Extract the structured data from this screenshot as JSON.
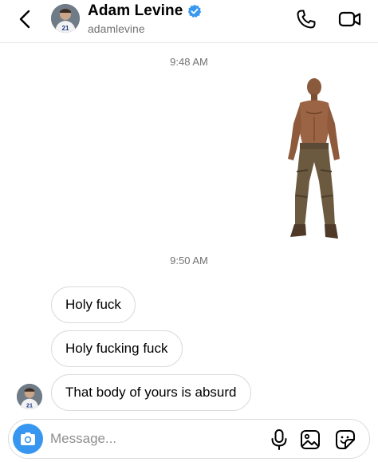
{
  "header": {
    "name": "Adam Levine",
    "handle": "adamlevine",
    "avatar_jersey_number": "21"
  },
  "thread": {
    "timestamp_1": "9:48 AM",
    "timestamp_2": "9:50 AM",
    "messages": [
      {
        "text": "Holy fuck"
      },
      {
        "text": "Holy fucking fuck"
      },
      {
        "text": "That body of yours is absurd"
      }
    ]
  },
  "composer": {
    "placeholder": "Message..."
  },
  "colors": {
    "accent": "#3797f0",
    "verified": "#3897f0",
    "muted_text": "#737373",
    "bubble_border": "#dbdbdb"
  },
  "icons": [
    "back-chevron-icon",
    "verified-badge-icon",
    "phone-icon",
    "video-camera-icon",
    "camera-icon",
    "microphone-icon",
    "gallery-icon",
    "sticker-icon"
  ]
}
